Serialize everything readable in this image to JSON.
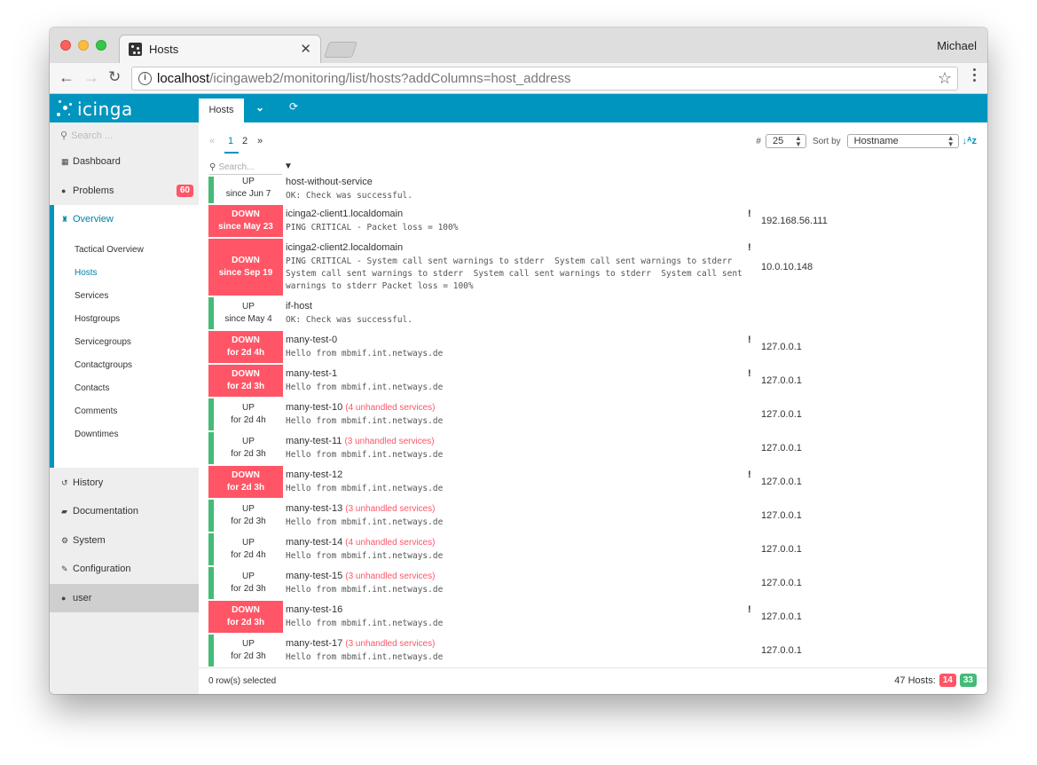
{
  "browser": {
    "tab_title": "Hosts",
    "profile_name": "Michael",
    "url_host": "localhost",
    "url_path": "/icingaweb2/monitoring/list/hosts?addColumns=host_address"
  },
  "app": {
    "logo_text": "icinga",
    "content_tab": "Hosts"
  },
  "sidebar": {
    "search_placeholder": "Search ...",
    "items": [
      {
        "label": "Dashboard",
        "icon": "grid-icon"
      },
      {
        "label": "Problems",
        "icon": "exclamation-circle-icon",
        "badge": "60"
      },
      {
        "label": "Overview",
        "icon": "binoculars-icon"
      },
      {
        "label": "History",
        "icon": "history-icon"
      },
      {
        "label": "Documentation",
        "icon": "book-icon"
      },
      {
        "label": "System",
        "icon": "cogs-icon"
      },
      {
        "label": "Configuration",
        "icon": "wrench-icon"
      },
      {
        "label": "user",
        "icon": "user-icon"
      }
    ],
    "overview_sub": [
      "Tactical Overview",
      "Hosts",
      "Services",
      "Hostgroups",
      "Servicegroups",
      "Contactgroups",
      "Contacts",
      "Comments",
      "Downtimes"
    ]
  },
  "main": {
    "pagination": {
      "prev": "«",
      "pages": [
        "1",
        "2"
      ],
      "next": "»",
      "current": "1"
    },
    "limit_label": "#",
    "limit_value": "25",
    "sort_label": "Sort by",
    "sort_value": "Hostname",
    "search_placeholder": "Search...",
    "rows": [
      {
        "state": "UP",
        "since": "since Jun 7",
        "name": "host-without-service",
        "unhandled": "",
        "output": "OK: Check was successful.",
        "ack": false,
        "address": ""
      },
      {
        "state": "DOWN",
        "since": "since May 23",
        "name": "icinga2-client1.localdomain",
        "unhandled": "",
        "output": "PING CRITICAL - Packet loss = 100%",
        "ack": true,
        "address": "192.168.56.111"
      },
      {
        "state": "DOWN",
        "since": "since Sep 19",
        "name": "icinga2-client2.localdomain",
        "unhandled": "",
        "output_lines": [
          "PING CRITICAL - System call sent warnings to stderr  System call sent warnings to stderr",
          "System call sent warnings to stderr  System call sent warnings to stderr  System call sent",
          "warnings to stderr Packet loss = 100%"
        ],
        "ack": true,
        "address": "10.0.10.148"
      },
      {
        "state": "UP",
        "since": "since May 4",
        "name": "if-host",
        "unhandled": "",
        "output": "OK: Check was successful.",
        "ack": false,
        "address": ""
      },
      {
        "state": "DOWN",
        "since": "for 2d 4h",
        "name": "many-test-0",
        "unhandled": "",
        "output": "Hello from mbmif.int.netways.de",
        "ack": true,
        "address": "127.0.0.1"
      },
      {
        "state": "DOWN",
        "since": "for 2d 3h",
        "name": "many-test-1",
        "unhandled": "",
        "output": "Hello from mbmif.int.netways.de",
        "ack": true,
        "address": "127.0.0.1"
      },
      {
        "state": "UP",
        "since": "for 2d 4h",
        "name": "many-test-10",
        "unhandled": "(4 unhandled services)",
        "output": "Hello from mbmif.int.netways.de",
        "ack": false,
        "address": "127.0.0.1"
      },
      {
        "state": "UP",
        "since": "for 2d 3h",
        "name": "many-test-11",
        "unhandled": "(3 unhandled services)",
        "output": "Hello from mbmif.int.netways.de",
        "ack": false,
        "address": "127.0.0.1"
      },
      {
        "state": "DOWN",
        "since": "for 2d 3h",
        "name": "many-test-12",
        "unhandled": "",
        "output": "Hello from mbmif.int.netways.de",
        "ack": true,
        "address": "127.0.0.1"
      },
      {
        "state": "UP",
        "since": "for 2d 3h",
        "name": "many-test-13",
        "unhandled": "(3 unhandled services)",
        "output": "Hello from mbmif.int.netways.de",
        "ack": false,
        "address": "127.0.0.1"
      },
      {
        "state": "UP",
        "since": "for 2d 4h",
        "name": "many-test-14",
        "unhandled": "(4 unhandled services)",
        "output": "Hello from mbmif.int.netways.de",
        "ack": false,
        "address": "127.0.0.1"
      },
      {
        "state": "UP",
        "since": "for 2d 3h",
        "name": "many-test-15",
        "unhandled": "(3 unhandled services)",
        "output": "Hello from mbmif.int.netways.de",
        "ack": false,
        "address": "127.0.0.1"
      },
      {
        "state": "DOWN",
        "since": "for 2d 3h",
        "name": "many-test-16",
        "unhandled": "",
        "output": "Hello from mbmif.int.netways.de",
        "ack": true,
        "address": "127.0.0.1"
      },
      {
        "state": "UP",
        "since": "for 2d 3h",
        "name": "many-test-17",
        "unhandled": "(3 unhandled services)",
        "output": "Hello from mbmif.int.netways.de",
        "ack": false,
        "address": "127.0.0.1"
      }
    ]
  },
  "footer": {
    "selected": "0 row(s) selected",
    "hosts_label": "47 Hosts:",
    "down_count": "14",
    "up_count": "33"
  },
  "colors": {
    "brand": "#0095bf",
    "down": "#ff5566",
    "up": "#44bb77"
  }
}
